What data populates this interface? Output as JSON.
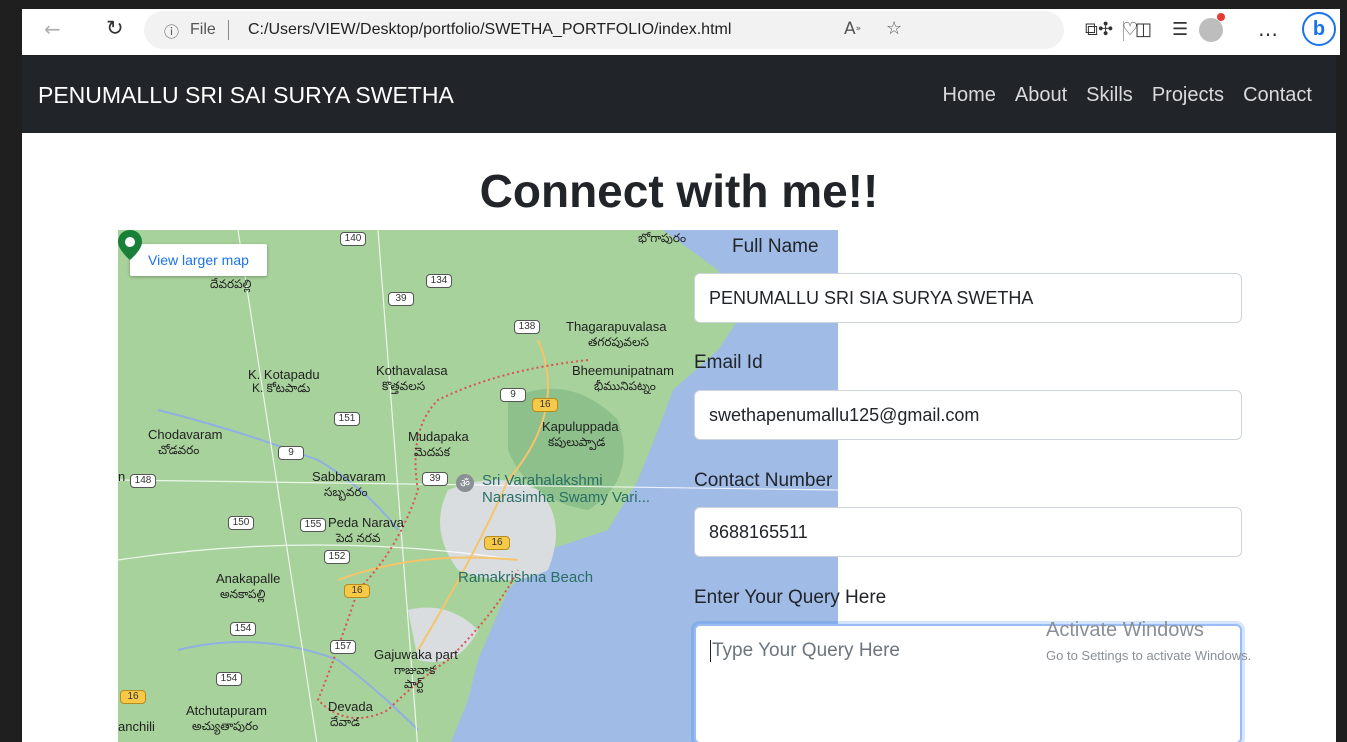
{
  "browser": {
    "address_file_label": "File",
    "url": "C:/Users/VIEW/Desktop/portfolio/SWETHA_PORTFOLIO/index.html"
  },
  "navbar": {
    "brand": "PENUMALLU SRI SAI SURYA SWETHA",
    "links": [
      "Home",
      "About",
      "Skills",
      "Projects",
      "Contact"
    ]
  },
  "section": {
    "heading": "Connect with me!!"
  },
  "map": {
    "button_label": "View larger map",
    "labels": {
      "devarapalli": "దేవరపల్లి",
      "thagarapuvalasa": "Thagarapuvalasa",
      "thagarapuvalasa_te": "తగరపువలస",
      "kotapadu": "K. Kotapadu",
      "kotapadu_te": "K. కోటపాడు",
      "kothavalasa": "Kothavalasa",
      "kothavalasa_te": "కొత్తవలస",
      "bheemunipatnam": "Bheemunipatnam",
      "bheemunipatnam_te": "భీమునిపట్నం",
      "chodavaram": "Chodavaram",
      "chodavaram_te": "చోడవరం",
      "mudapaka": "Mudapaka",
      "mudapaka_te": "మెదపక",
      "kapuluppada": "Kapuluppada",
      "kapuluppada_te": "కపులుప్పాడ",
      "sabbavaram": "Sabbavaram",
      "sabbavaram_te": "సబ్బవరం",
      "temple_1": "Sri Varahalakshmi",
      "temple_2": "Narasimha Swamy Vari...",
      "peda_narava": "Peda Narava",
      "peda_narava_te": "పెద నరవ",
      "ramakrishna": "Ramakrishna Beach",
      "anakapalle": "Anakapalle",
      "anakapalle_te": "అనకాపల్లి",
      "gajuwaka": "Gajuwaka part",
      "gajuwaka_te1": "గాజువాక",
      "gajuwaka_te2": "పార్ట్",
      "atchutapuram": "Atchutapuram",
      "atchutapuram_te": "అచ్యుతాపురం",
      "devada": "Devada",
      "devada_te": "దేవాడ",
      "anchili": "anchili",
      "bhogapuram_te": "భోగాపురం",
      "edge_n": "n"
    },
    "shields": [
      "140",
      "134",
      "39",
      "138",
      "9",
      "16",
      "151",
      "9",
      "39",
      "148",
      "150",
      "155",
      "16",
      "152",
      "16",
      "154",
      "157",
      "154",
      "16"
    ]
  },
  "form": {
    "full_name_label": "Full Name",
    "full_name_value": "PENUMALLU SRI SIA SURYA SWETHA",
    "email_label": "Email Id",
    "email_value": "swethapenumallu125@gmail.com",
    "contact_label": "Contact Number",
    "contact_value": "8688165511",
    "query_label": "Enter Your Query Here",
    "query_placeholder": "Type Your Query Here"
  },
  "watermark": {
    "title": "Activate Windows",
    "subtitle": "Go to Settings to activate Windows."
  }
}
